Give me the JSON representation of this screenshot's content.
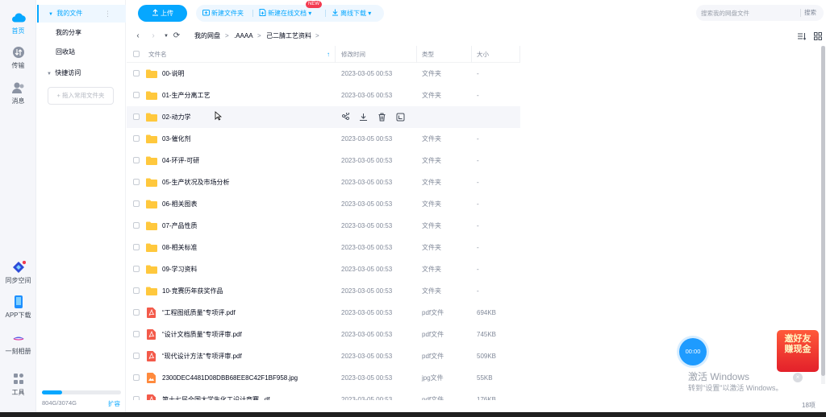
{
  "rail": {
    "items": [
      {
        "label": "首页",
        "icon": "cloud-home-icon",
        "active": true
      },
      {
        "label": "传输",
        "icon": "transfer-icon",
        "active": false
      },
      {
        "label": "消息",
        "icon": "messages-icon",
        "active": false
      },
      {
        "label": "同步空间",
        "icon": "sync-space-icon",
        "active": false
      },
      {
        "label": "APP下载",
        "icon": "phone-download-icon",
        "active": false
      },
      {
        "label": "一刻相册",
        "icon": "album-icon",
        "active": false
      },
      {
        "label": "工具",
        "icon": "tools-grid-icon",
        "active": false
      }
    ]
  },
  "side": {
    "my_files": "我的文件",
    "my_shares": "我的分享",
    "recycle": "回收站",
    "quick_access": "快捷访问",
    "add_quick": "+ 拖入常用文件夹",
    "quota_text": "804G/3074G",
    "quota_fraction": 0.26,
    "expand": "扩容"
  },
  "toolbar": {
    "upload": "上传",
    "new_folder": "新建文件夹",
    "new_online_doc": "新建在线文档",
    "new_badge": "NEW",
    "offline_download": "离线下载",
    "search_placeholder": "搜索我的网盘文件",
    "search_button": "搜索"
  },
  "breadcrumb": {
    "items": [
      "我的网盘",
      ".AAAA",
      "己二腈工艺资料"
    ],
    "separator": ">"
  },
  "table": {
    "headers": {
      "name": "文件名",
      "modified": "修改时间",
      "type": "类型",
      "size": "大小"
    },
    "rows": [
      {
        "name": "00-说明",
        "modified": "2023-03-05 00:53",
        "type": "文件夹",
        "size": "-",
        "kind": "folder"
      },
      {
        "name": "01-生产分离工艺",
        "modified": "2023-03-05 00:53",
        "type": "文件夹",
        "size": "-",
        "kind": "folder"
      },
      {
        "name": "02-动力学",
        "modified": "",
        "type": "",
        "size": "",
        "kind": "folder",
        "hover": true
      },
      {
        "name": "03-催化剂",
        "modified": "2023-03-05 00:53",
        "type": "文件夹",
        "size": "-",
        "kind": "folder"
      },
      {
        "name": "04-环评-可研",
        "modified": "2023-03-05 00:53",
        "type": "文件夹",
        "size": "-",
        "kind": "folder"
      },
      {
        "name": "05-生产状况及市场分析",
        "modified": "2023-03-05 00:53",
        "type": "文件夹",
        "size": "-",
        "kind": "folder"
      },
      {
        "name": "06-相关图表",
        "modified": "2023-03-05 00:53",
        "type": "文件夹",
        "size": "-",
        "kind": "folder"
      },
      {
        "name": "07-产品性质",
        "modified": "2023-03-05 00:53",
        "type": "文件夹",
        "size": "-",
        "kind": "folder"
      },
      {
        "name": "08-相关标准",
        "modified": "2023-03-05 00:53",
        "type": "文件夹",
        "size": "-",
        "kind": "folder"
      },
      {
        "name": "09-学习资料",
        "modified": "2023-03-05 00:53",
        "type": "文件夹",
        "size": "-",
        "kind": "folder"
      },
      {
        "name": "10-竞赛历年获奖作品",
        "modified": "2023-03-05 00:53",
        "type": "文件夹",
        "size": "-",
        "kind": "folder"
      },
      {
        "name": "“工程图纸质量”专项评.pdf",
        "modified": "2023-03-05 00:53",
        "type": "pdf文件",
        "size": "694KB",
        "kind": "pdf"
      },
      {
        "name": "“设计文档质量”专项评审.pdf",
        "modified": "2023-03-05 00:53",
        "type": "pdf文件",
        "size": "745KB",
        "kind": "pdf"
      },
      {
        "name": "“现代设计方法”专项评审.pdf",
        "modified": "2023-03-05 00:53",
        "type": "pdf文件",
        "size": "509KB",
        "kind": "pdf"
      },
      {
        "name": "2300DEC4481D08DBB68EE8C42F1BF958.jpg",
        "modified": "2023-03-05 00:53",
        "type": "jpg文件",
        "size": "55KB",
        "kind": "jpg"
      },
      {
        "name": "第十七届全国大学生化工设计竞赛...df",
        "modified": "2023-03-05 00:53",
        "type": "pdf文件",
        "size": "176KB",
        "kind": "pdf"
      }
    ],
    "hover_actions": [
      "share-icon",
      "download-icon",
      "delete-icon",
      "more-icon"
    ]
  },
  "promo": {
    "line1": "邀好友",
    "line2": "赚现金"
  },
  "float_timer": "00:00",
  "watermark": {
    "line1": "激活 Windows",
    "line2": "转到\"设置\"以激活 Windows。"
  },
  "count": "18项",
  "colors": {
    "accent": "#06a7ff",
    "folder": "#ffc83d",
    "pdf": "#f35a4a",
    "jpg": "#ff8a3d"
  }
}
